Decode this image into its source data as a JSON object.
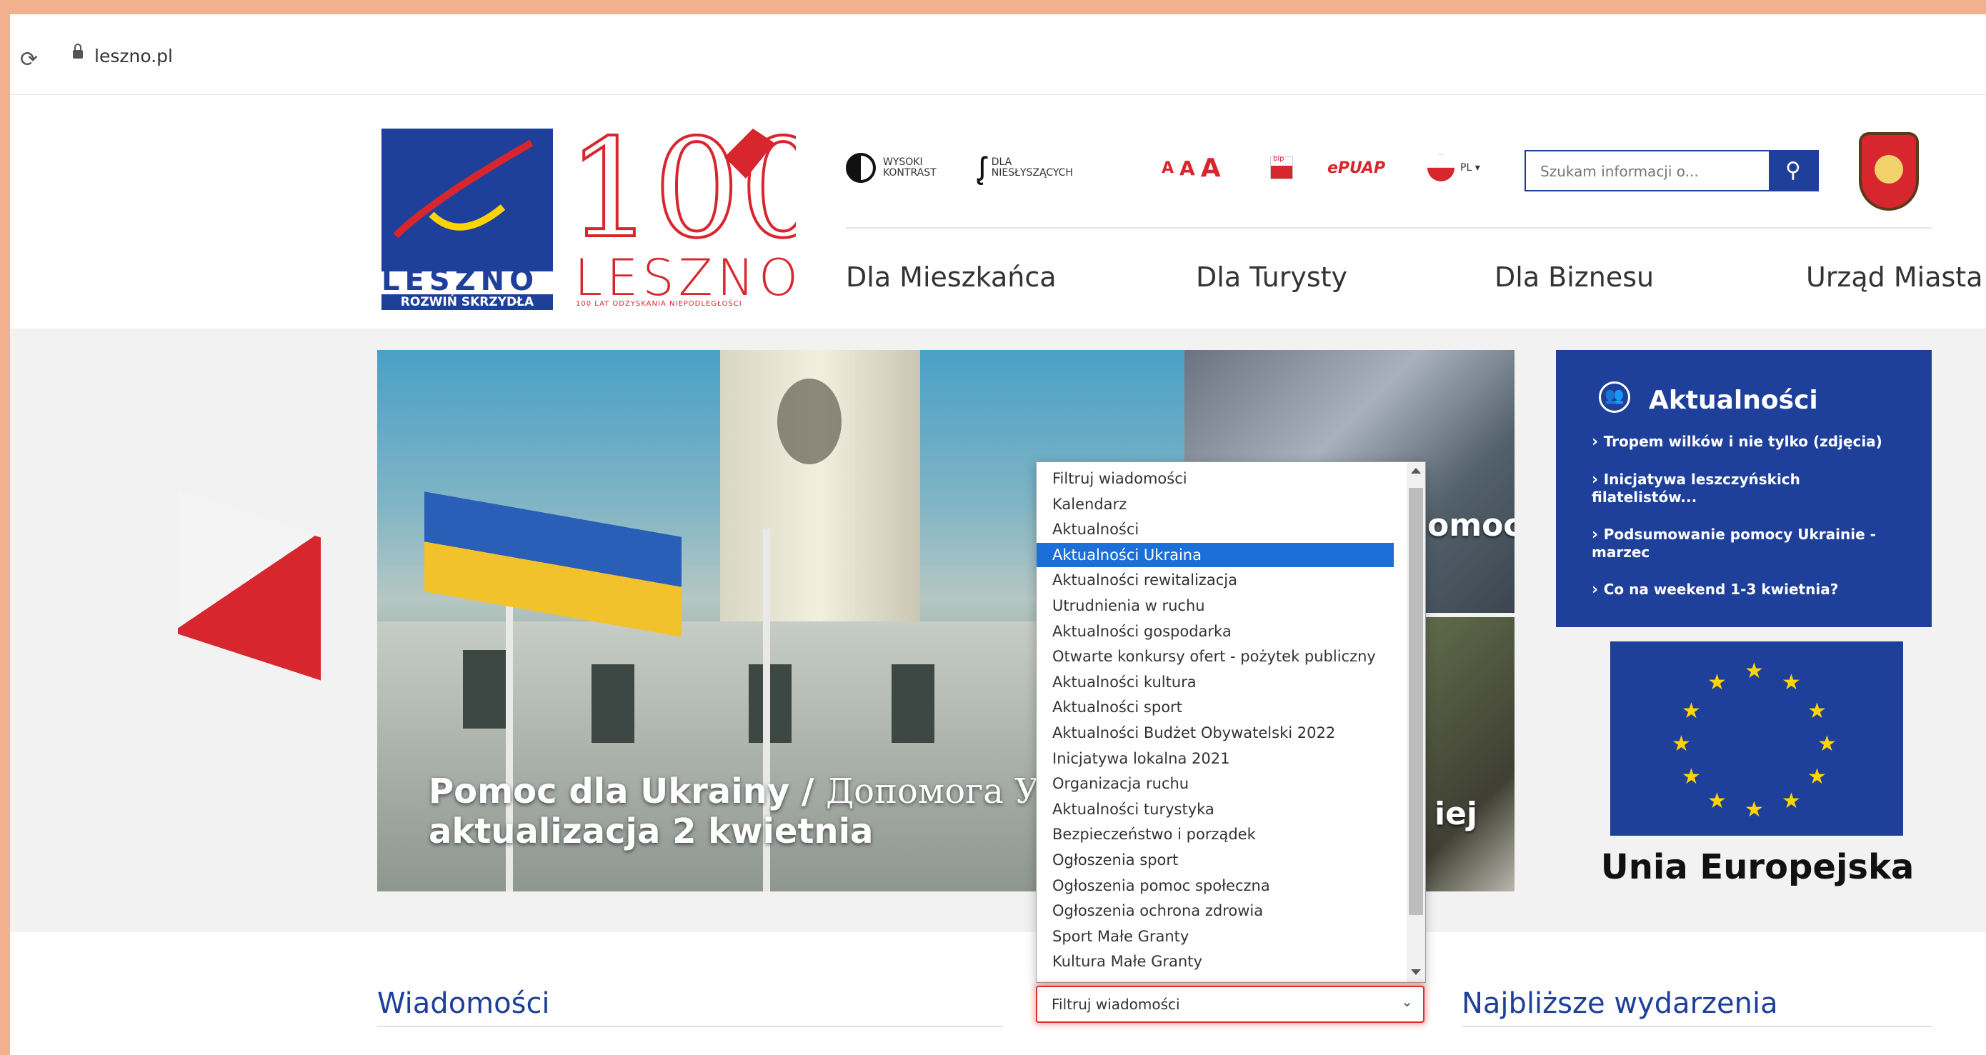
{
  "browser": {
    "url": "leszno.pl",
    "reload_icon": "reload-icon",
    "lock_icon": "lock-icon"
  },
  "header": {
    "logo_main": {
      "word": "LESZNO",
      "tagline": "ROZWIŃ SKRZYDŁA"
    },
    "logo_100": {
      "word": "LESZNO",
      "subtitle": "100 LAT ODZYSKANIA NIEPODLEGŁOŚCI"
    },
    "utilities": {
      "contrast_line1": "WYSOKI",
      "contrast_line2": "KONTRAST",
      "deaf_line1": "DLA",
      "deaf_line2": "NIESŁYSZĄCYCH",
      "font_a1": "A",
      "font_a2": "A",
      "font_a3": "A",
      "bip": "bip",
      "epuap": "ePUAP",
      "lang": "PL ▾"
    },
    "search": {
      "placeholder": "Szukam informacji o...",
      "icon": "search-icon"
    },
    "nav": [
      "Dla Mieszkańca",
      "Dla Turysty",
      "Dla Biznesu",
      "Urząd Miasta"
    ]
  },
  "hero": {
    "title_line1_lat": "Pomoc dla Ukrainy / ",
    "title_line1_cyr": "Допомога Украї",
    "title_line2": "aktualizacja 2 kwietnia"
  },
  "tiles": {
    "tile1_text": "omocy",
    "tile2_text": "iej"
  },
  "news_box": {
    "title": "Aktualności",
    "items": [
      "Tropem wilków i nie tylko (zdjęcia)",
      "Inicjatywa leszczyńskich filatelistów...",
      "Podsumowanie pomocy Ukrainie - marzec",
      "Co na weekend 1-3 kwietnia?"
    ]
  },
  "eu": {
    "label": "Unia Europejska"
  },
  "sections": {
    "news": "Wiadomości",
    "events": "Najbliższe wydarzenia"
  },
  "filter": {
    "selected_value": "Filtruj wiadomości",
    "highlighted_index": 3,
    "options": [
      "Filtruj wiadomości",
      "Kalendarz",
      "Aktualności",
      "Aktualności Ukraina",
      "Aktualności rewitalizacja",
      "Utrudnienia w ruchu",
      "Aktualności gospodarka",
      "Otwarte konkursy ofert - pożytek publiczny",
      "Aktualności kultura",
      "Aktualności sport",
      "Aktualności Budżet Obywatelski 2022",
      "Inicjatywa lokalna 2021",
      "Organizacja ruchu",
      "Aktualności turystyka",
      "Bezpieczeństwo i porządek",
      "Ogłoszenia sport",
      "Ogłoszenia pomoc społeczna",
      "Ogłoszenia ochrona zdrowia",
      "Sport Małe Granty",
      "Kultura Małe Granty"
    ]
  },
  "colors": {
    "brand_blue": "#1e3f9a",
    "brand_red": "#d8262e",
    "frame": "#f3b08e",
    "highlight": "#1a6fd8"
  }
}
